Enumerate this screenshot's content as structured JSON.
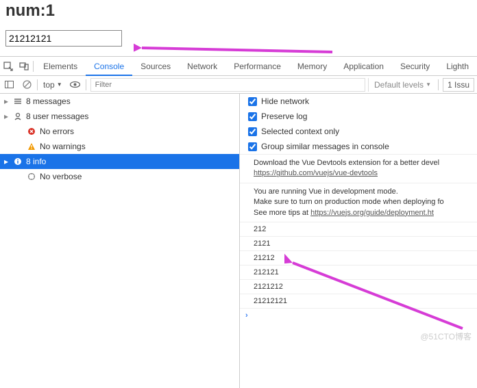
{
  "page": {
    "num_label": "num:1",
    "input_value": "21212121"
  },
  "tabs": {
    "elements": "Elements",
    "console": "Console",
    "sources": "Sources",
    "network": "Network",
    "performance": "Performance",
    "memory": "Memory",
    "application": "Application",
    "security": "Security",
    "lighthouse": "Lighth"
  },
  "toolbar": {
    "context": "top",
    "filter_placeholder": "Filter",
    "default_levels": "Default levels",
    "issues": "1 Issu"
  },
  "sidebar": {
    "messages": "8 messages",
    "user_messages": "8 user messages",
    "no_errors": "No errors",
    "no_warnings": "No warnings",
    "info": "8 info",
    "no_verbose": "No verbose"
  },
  "options": {
    "hide_network": "Hide network",
    "preserve_log": "Preserve log",
    "selected_context": "Selected context only",
    "group_similar": "Group similar messages in console"
  },
  "messages": {
    "devtools_text": "Download the Vue Devtools extension for a better devel",
    "devtools_link": "https://github.com/vuejs/vue-devtools",
    "vue_run_1": "You are running Vue in development mode.",
    "vue_run_2": "Make sure to turn on production mode when deploying fo",
    "vue_run_3a": "See more tips at ",
    "vue_run_3b": "https://vuejs.org/guide/deployment.ht",
    "logs": [
      "212",
      "2121",
      "21212",
      "212121",
      "2121212",
      "21212121"
    ]
  },
  "watermark": "@51CTO博客"
}
